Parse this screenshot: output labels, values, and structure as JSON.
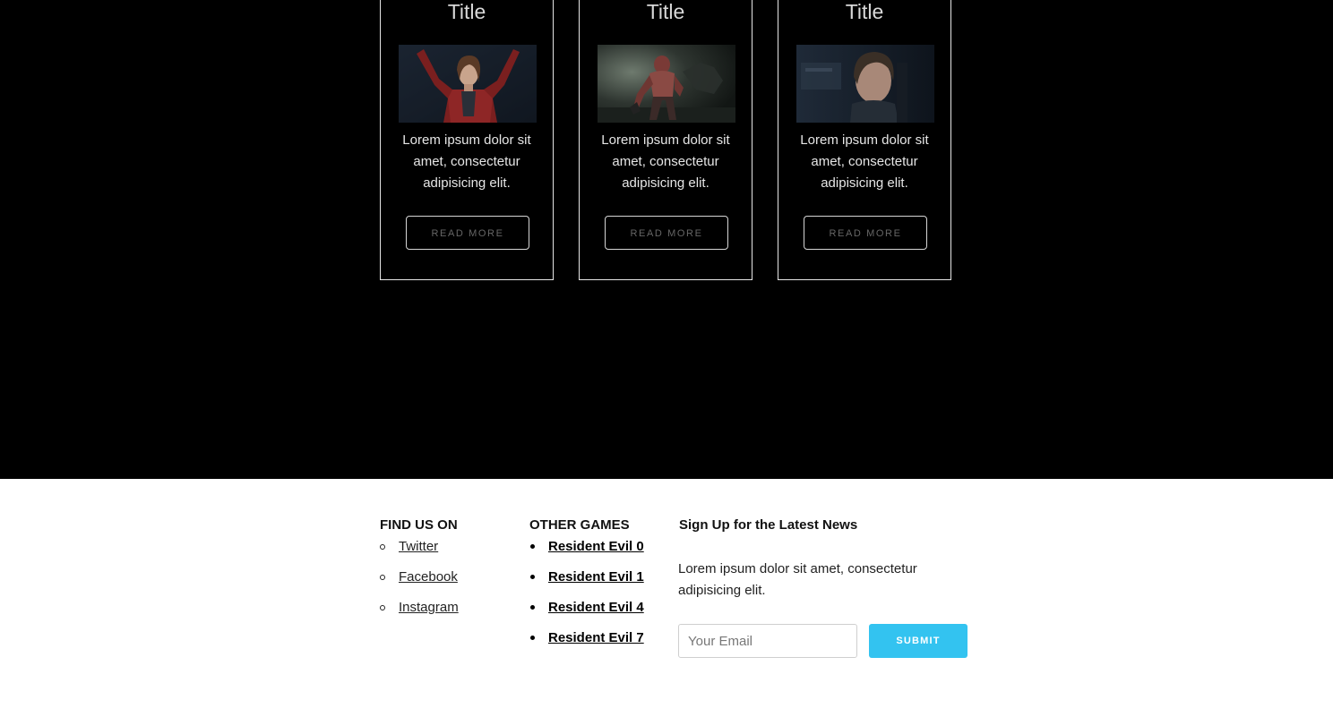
{
  "colors": {
    "dark_bg": "#000000",
    "footer_bg": "#ffffff",
    "accent": "#33c3f0",
    "card_border": "#e6e6e6"
  },
  "cards": [
    {
      "title": "Title",
      "image_icon": "woman-in-red-jacket-image",
      "text": "Lorem ipsum dolor sit amet, consectetur adipisicing elit.",
      "button_label": "READ MORE"
    },
    {
      "title": "Title",
      "image_icon": "monster-in-dark-hallway-image",
      "text": "Lorem ipsum dolor sit amet, consectetur adipisicing elit.",
      "button_label": "READ MORE"
    },
    {
      "title": "Title",
      "image_icon": "man-portrait-dark-image",
      "text": "Lorem ipsum dolor sit amet, consectetur adipisicing elit.",
      "button_label": "READ MORE"
    }
  ],
  "footer": {
    "social": {
      "title": "FIND US ON",
      "links": [
        "Twitter",
        "Facebook",
        "Instagram"
      ]
    },
    "games": {
      "title": "OTHER GAMES",
      "links": [
        "Resident Evil 0",
        "Resident Evil 1",
        "Resident Evil 4",
        "Resident Evil 7"
      ]
    },
    "signup": {
      "title": "Sign Up for the Latest News",
      "text": "Lorem ipsum dolor sit amet, consectetur adipisicing elit.",
      "email_placeholder": "Your Email",
      "email_value": "",
      "submit_label": "SUBMIT"
    }
  }
}
